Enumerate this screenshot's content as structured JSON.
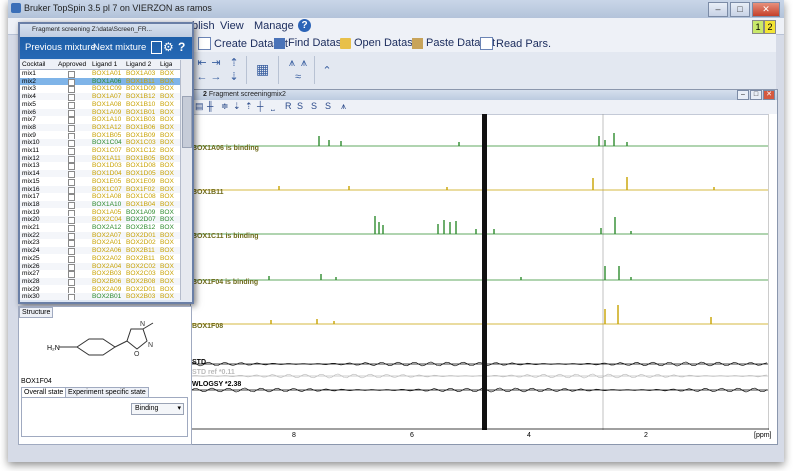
{
  "window": {
    "title": "Bruker TopSpin 3.5 pl 7 on VIERZON as ramos",
    "minimize": "–",
    "maximize": "□",
    "close": "✕"
  },
  "menubar": {
    "items": [
      "blish",
      "View",
      "Manage"
    ],
    "badges": [
      "1",
      "2"
    ],
    "help_icon": "help-icon"
  },
  "toolbar": {
    "buttons": [
      "Create Dataset",
      "Find Dataset",
      "Open Dataset",
      "Paste Dataset",
      "Read Pars."
    ]
  },
  "spectrum": {
    "title": "Fragment screeningmix2",
    "window_number": "2",
    "tool_labels": [
      "R",
      "S",
      "S",
      "S"
    ],
    "traces": [
      {
        "label": "BOX1A06  is binding",
        "color": "#6e6a1a",
        "line": "#2e8b2e"
      },
      {
        "label": "BOX1B11",
        "color": "#6e6a1a",
        "line": "#c8a200"
      },
      {
        "label": "BOX1C11  is binding",
        "color": "#6e6a1a",
        "line": "#2e8b2e"
      },
      {
        "label": "BOX1F04  is binding",
        "color": "#6e6a1a",
        "line": "#2e8b2e"
      },
      {
        "label": "BOX1F08",
        "color": "#6e6a1a",
        "line": "#c8a200"
      },
      {
        "label": "STD",
        "color": "#000000",
        "line": "#000000"
      },
      {
        "label": "STD ref *0.11",
        "color": "#bbbbbb",
        "line": "#bbbbbb"
      },
      {
        "label": "WLOGSY *2.38",
        "color": "#000000",
        "line": "#000000"
      }
    ],
    "x_ticks": [
      "8",
      "6",
      "4",
      "2"
    ],
    "x_unit": "[ppm]"
  },
  "dialog": {
    "title": "Fragment screening   Z:\\data\\Screen_FR...",
    "prev_label": "Previous mixture",
    "next_label": "Next mixture",
    "columns": [
      "Cocktail",
      "Approved",
      "Ligand 1",
      "Ligand 2",
      "Liga"
    ],
    "rows": [
      {
        "cocktail": "mix1",
        "l1": "BOX1A01",
        "l2": "BOX1A03",
        "l3": "BOX",
        "c1": "#c8a200",
        "c2": "#c8a200",
        "sel": false
      },
      {
        "cocktail": "mix2",
        "l1": "BOX1A06",
        "l2": "BOX1B11",
        "l3": "BOX",
        "c1": "#2e8b2e",
        "c2": "#c8a200",
        "sel": true
      },
      {
        "cocktail": "mix3",
        "l1": "BOX1C09",
        "l2": "BOX1D09",
        "l3": "BOX",
        "c1": "#c8a200",
        "c2": "#c8a200",
        "sel": false
      },
      {
        "cocktail": "mix4",
        "l1": "BOX1A07",
        "l2": "BOX1B12",
        "l3": "BOX",
        "c1": "#c8a200",
        "c2": "#c8a200",
        "sel": false
      },
      {
        "cocktail": "mix5",
        "l1": "BOX1A08",
        "l2": "BOX1B10",
        "l3": "BOX",
        "c1": "#c8a200",
        "c2": "#c8a200",
        "sel": false
      },
      {
        "cocktail": "mix6",
        "l1": "BOX1A09",
        "l2": "BOX1B01",
        "l3": "BOX",
        "c1": "#c8a200",
        "c2": "#c8a200",
        "sel": false
      },
      {
        "cocktail": "mix7",
        "l1": "BOX1A10",
        "l2": "BOX1B03",
        "l3": "BOX",
        "c1": "#c8a200",
        "c2": "#c8a200",
        "sel": false
      },
      {
        "cocktail": "mix8",
        "l1": "BOX1A12",
        "l2": "BOX1B06",
        "l3": "BOX",
        "c1": "#c8a200",
        "c2": "#c8a200",
        "sel": false
      },
      {
        "cocktail": "mix9",
        "l1": "BOX1B05",
        "l2": "BOX1B09",
        "l3": "BOX",
        "c1": "#c8a200",
        "c2": "#c8a200",
        "sel": false
      },
      {
        "cocktail": "mix10",
        "l1": "BOX1C04",
        "l2": "BOX1C03",
        "l3": "BOX",
        "c1": "#2e8b2e",
        "c2": "#c8a200",
        "sel": false
      },
      {
        "cocktail": "mix11",
        "l1": "BOX1C07",
        "l2": "BOX1C12",
        "l3": "BOX",
        "c1": "#c8a200",
        "c2": "#c8a200",
        "sel": false
      },
      {
        "cocktail": "mix12",
        "l1": "BOX1A11",
        "l2": "BOX1B05",
        "l3": "BOX",
        "c1": "#c8a200",
        "c2": "#c8a200",
        "sel": false
      },
      {
        "cocktail": "mix13",
        "l1": "BOX1D03",
        "l2": "BOX1D08",
        "l3": "BOX",
        "c1": "#c8a200",
        "c2": "#c8a200",
        "sel": false
      },
      {
        "cocktail": "mix14",
        "l1": "BOX1D04",
        "l2": "BOX1D05",
        "l3": "BOX",
        "c1": "#c8a200",
        "c2": "#c8a200",
        "sel": false
      },
      {
        "cocktail": "mix15",
        "l1": "BOX1E05",
        "l2": "BOX1E09",
        "l3": "BOX",
        "c1": "#c8a200",
        "c2": "#c8a200",
        "sel": false
      },
      {
        "cocktail": "mix16",
        "l1": "BOX1C07",
        "l2": "BOX1F02",
        "l3": "BOX",
        "c1": "#c8a200",
        "c2": "#c8a200",
        "sel": false
      },
      {
        "cocktail": "mix17",
        "l1": "BOX1A08",
        "l2": "BOX1C08",
        "l3": "BOX",
        "c1": "#c8a200",
        "c2": "#c8a200",
        "sel": false
      },
      {
        "cocktail": "mix18",
        "l1": "BOX1A10",
        "l2": "BOX1B04",
        "l3": "BOX",
        "c1": "#2e8b2e",
        "c2": "#c8a200",
        "sel": false
      },
      {
        "cocktail": "mix19",
        "l1": "BOX1A05",
        "l2": "BOX1A09",
        "l3": "BOX",
        "c1": "#c8a200",
        "c2": "#2e8b2e",
        "sel": false
      },
      {
        "cocktail": "mix20",
        "l1": "BOX2C04",
        "l2": "BOX2D07",
        "l3": "BOX",
        "c1": "#c8a200",
        "c2": "#2e8b2e",
        "sel": false
      },
      {
        "cocktail": "mix21",
        "l1": "BOX2A12",
        "l2": "BOX2B12",
        "l3": "BOX",
        "c1": "#2e8b2e",
        "c2": "#2e8b2e",
        "sel": false
      },
      {
        "cocktail": "mix22",
        "l1": "BOX2A07",
        "l2": "BOX2D01",
        "l3": "BOX",
        "c1": "#c8a200",
        "c2": "#c8a200",
        "sel": false
      },
      {
        "cocktail": "mix23",
        "l1": "BOX2A01",
        "l2": "BOX2D02",
        "l3": "BOX",
        "c1": "#c8a200",
        "c2": "#c8a200",
        "sel": false
      },
      {
        "cocktail": "mix24",
        "l1": "BOX2A06",
        "l2": "BOX2B11",
        "l3": "BOX",
        "c1": "#c8a200",
        "c2": "#c8a200",
        "sel": false
      },
      {
        "cocktail": "mix25",
        "l1": "BOX2A02",
        "l2": "BOX2B11",
        "l3": "BOX",
        "c1": "#c8a200",
        "c2": "#c8a200",
        "sel": false
      },
      {
        "cocktail": "mix26",
        "l1": "BOX2A04",
        "l2": "BOX2C02",
        "l3": "BOX",
        "c1": "#c8a200",
        "c2": "#c8a200",
        "sel": false
      },
      {
        "cocktail": "mix27",
        "l1": "BOX2B03",
        "l2": "BOX2C03",
        "l3": "BOX",
        "c1": "#c8a200",
        "c2": "#c8a200",
        "sel": false
      },
      {
        "cocktail": "mix28",
        "l1": "BOX2B06",
        "l2": "BOX2B08",
        "l3": "BOX",
        "c1": "#c8a200",
        "c2": "#c8a200",
        "sel": false
      },
      {
        "cocktail": "mix29",
        "l1": "BOX2A09",
        "l2": "BOX2D01",
        "l3": "BOX",
        "c1": "#c8a200",
        "c2": "#c8a200",
        "sel": false
      },
      {
        "cocktail": "mix30",
        "l1": "BOX2B01",
        "l2": "BOX2B03",
        "l3": "BOX",
        "c1": "#2e8b2e",
        "c2": "#c8a200",
        "sel": false
      }
    ]
  },
  "structure_panel": {
    "tab": "Structure",
    "compound": "BOX1F04",
    "atoms": {
      "amine": "H₂N",
      "o": "O",
      "n1": "N",
      "n2": "N"
    },
    "tabs": [
      "Overall state",
      "Experiment specific state"
    ],
    "state_value": "Binding",
    "dropdown_arrow": "▾"
  }
}
